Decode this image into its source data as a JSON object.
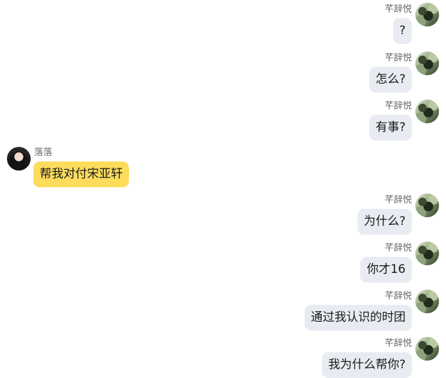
{
  "messages": [
    {
      "side": "right",
      "sender": "芊辞悦",
      "text": "?",
      "avatar_icon": "user-avatar-icon"
    },
    {
      "side": "right",
      "sender": "芊辞悦",
      "text": "怎么?",
      "avatar_icon": "user-avatar-icon"
    },
    {
      "side": "right",
      "sender": "芊辞悦",
      "text": "有事?",
      "avatar_icon": "user-avatar-icon"
    },
    {
      "side": "left",
      "sender": "落落",
      "text": "帮我对付宋亚轩",
      "avatar_icon": "contact-avatar-icon"
    },
    {
      "side": "right",
      "sender": "芊辞悦",
      "text": "为什么?",
      "avatar_icon": "user-avatar-icon"
    },
    {
      "side": "right",
      "sender": "芊辞悦",
      "text": "你才16",
      "avatar_icon": "user-avatar-icon"
    },
    {
      "side": "right",
      "sender": "芊辞悦",
      "text": "通过我认识的时团",
      "avatar_icon": "user-avatar-icon"
    },
    {
      "side": "right",
      "sender": "芊辞悦",
      "text": "我为什么帮你?",
      "avatar_icon": "user-avatar-icon"
    }
  ],
  "colors": {
    "right_bubble": "#e8ecf2",
    "left_bubble": "#fddc5c",
    "name_text": "#666666",
    "message_text": "#1a1a1a",
    "background": "#ffffff"
  }
}
